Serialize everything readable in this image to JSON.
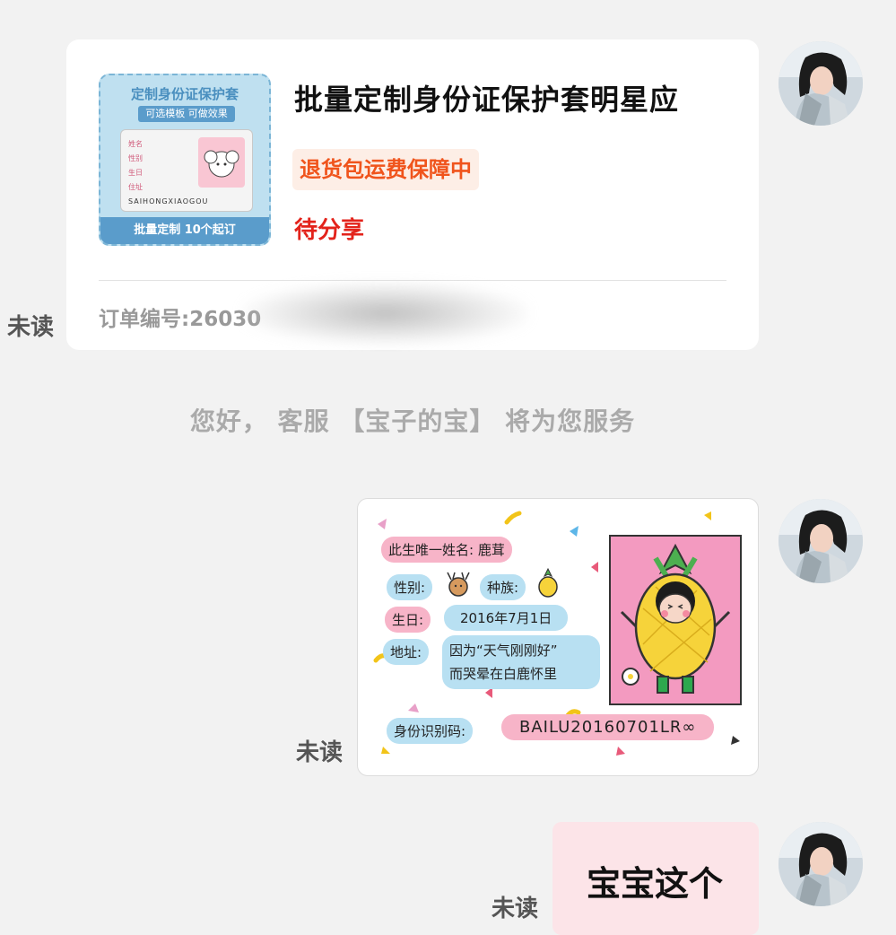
{
  "order_card": {
    "product_image": {
      "title": "定制身份证保护套",
      "subtitle": "可选模板 可做效果",
      "fields": [
        "姓名",
        "性别",
        "生日",
        "住址"
      ],
      "code": "SAIHONGXIAOGOU",
      "footer": "批量定制 10个起订"
    },
    "product_title": "批量定制身份证保护套明星应",
    "return_badge": "退货包运费保障中",
    "share_status": "待分享",
    "order_number_label": "订单编号:26030",
    "unread_label": "未读"
  },
  "system_message": "您好， 客服 【宝子的宝】 将为您服务",
  "image_message": {
    "name_label": "此生唯一姓名:",
    "name_value": "鹿茸",
    "gender_label": "性别:",
    "species_label": "种族:",
    "birthday_label": "生日:",
    "birthday_value": "2016年7月1日",
    "address_label": "地址:",
    "address_line1": "因为“天气刚刚好”",
    "address_line2": "而哭晕在白鹿怀里",
    "id_label": "身份识别码:",
    "id_value": "BAILU20160701LR∞",
    "unread_label": "未读"
  },
  "text_message": {
    "text": "宝宝这个",
    "unread_label": "未读"
  },
  "colors": {
    "background": "#f2f2f2",
    "return_badge_text": "#f0541c",
    "share_status_text": "#e3231b",
    "text_bubble": "#fce4e8"
  }
}
